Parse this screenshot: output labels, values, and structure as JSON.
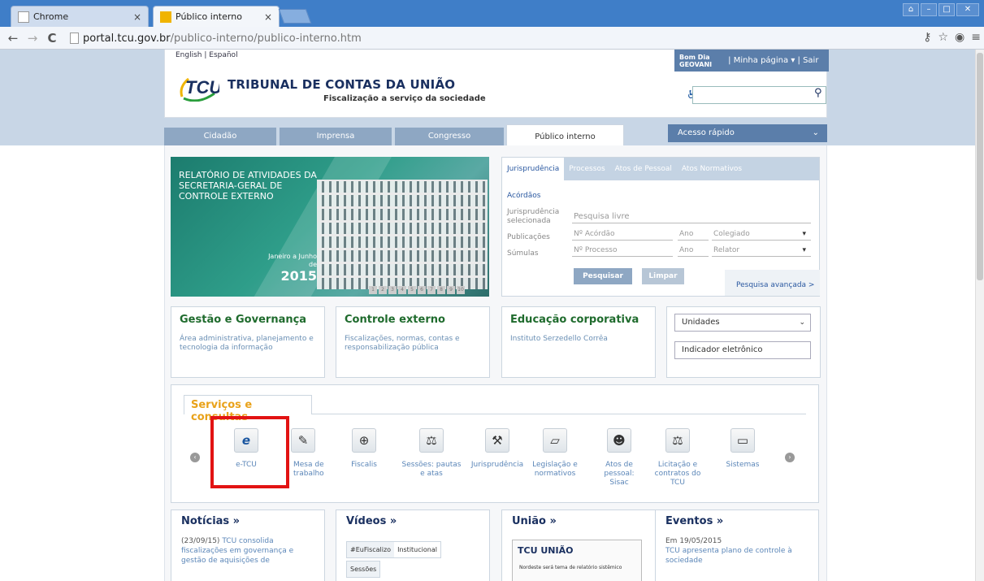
{
  "browser": {
    "tabs": [
      {
        "label": "Chrome"
      },
      {
        "label": "Público interno"
      }
    ],
    "url_host": "portal.tcu.gov.br",
    "url_path": "/publico-interno/publico-interno.htm"
  },
  "header": {
    "lang": "English | Español",
    "org_name": "TRIBUNAL DE CONTAS DA UNIÃO",
    "tagline": "Fiscalização a serviço da sociedade",
    "greeting": "Bom Dia\nGEOVANI",
    "user_links": "| Minha página ▾ | Sair"
  },
  "nav": {
    "tabs": [
      "Cidadão",
      "Imprensa",
      "Congresso",
      "Público interno"
    ],
    "quick": "Acesso rápido"
  },
  "banner": {
    "title": "RELATÓRIO DE ATIVIDADES DA SECRETARIA-GERAL DE CONTROLE EXTERNO",
    "period": "Janeiro a Junho de",
    "year": "2015",
    "pages": [
      "1",
      "2",
      "3",
      "4",
      "5",
      "6",
      "7",
      "8",
      "9",
      "10"
    ]
  },
  "search": {
    "tabs": [
      "Jurisprudência",
      "Processos",
      "Atos de Pessoal",
      "Atos Normativos"
    ],
    "left": [
      "Acórdãos",
      "Jurisprudência selecionada",
      "Publicações",
      "Súmulas"
    ],
    "free": "Pesquisa livre",
    "acordao": "Nº Acórdão",
    "ano": "Ano",
    "colegiado": "Colegiado",
    "processo": "Nº Processo",
    "relator": "Relator",
    "btn_search": "Pesquisar",
    "btn_clear": "Limpar",
    "advanced": "Pesquisa avançada >"
  },
  "boxes": [
    {
      "title": "Gestão e Governança",
      "desc": "Área administrativa, planejamento e tecnologia da informação"
    },
    {
      "title": "Controle externo",
      "desc": "Fiscalizações, normas, contas e responsabilização pública"
    },
    {
      "title": "Educação corporativa",
      "desc": "Instituto Serzedello Corrêa"
    }
  ],
  "select_units": "Unidades",
  "indicator": "Indicador eletrônico",
  "services": {
    "title": "Serviços e consultas",
    "items": [
      "e-TCU",
      "Mesa de trabalho",
      "Fiscalis",
      "Sessões: pautas e atas",
      "Jurisprudência",
      "Legislação e normativos",
      "Atos de pessoal: Sisac",
      "Licitação e contratos do TCU",
      "Sistemas"
    ]
  },
  "bottom": {
    "news_title": "Notícias »",
    "news_date": "(23/09/15)",
    "news_text": "TCU consolida fiscalizações em governança e gestão de aquisições de",
    "videos_title": "Vídeos »",
    "video_tabs": [
      "#EuFiscalizo",
      "Institucional"
    ],
    "video_tab2": "Sessões",
    "uniao_title": "União »",
    "paper_logo": "TCU UNIÃO",
    "paper_headline": "Nordeste será tema de relatório sistêmico",
    "events_title": "Eventos »",
    "event_date": "Em 19/05/2015",
    "event_text": "TCU apresenta plano de controle à sociedade"
  }
}
